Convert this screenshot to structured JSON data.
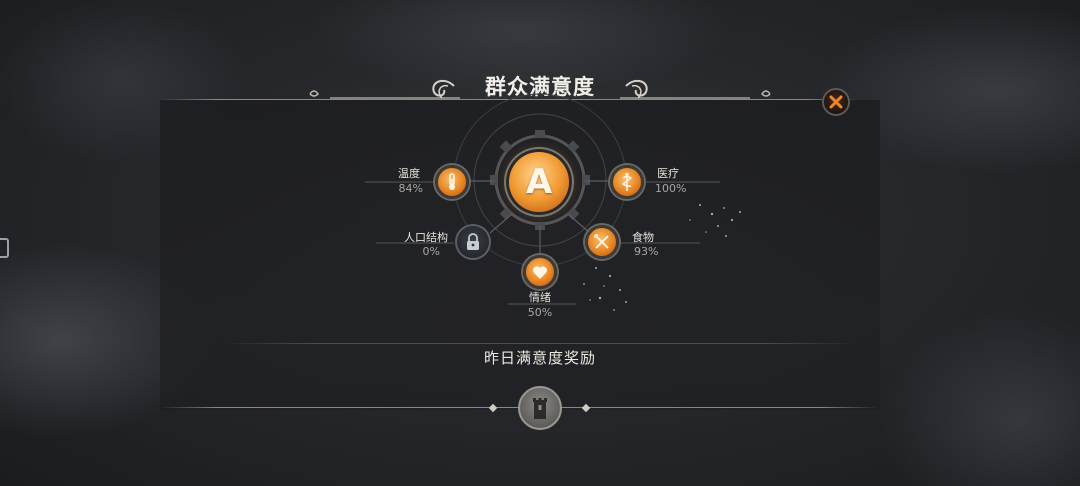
{
  "panel": {
    "title": "群众满意度",
    "grade": "A",
    "reward_title": "昨日满意度奖励"
  },
  "factors": {
    "temperature": {
      "label": "温度",
      "value": "84%",
      "icon": "thermometer-icon"
    },
    "medical": {
      "label": "医疗",
      "value": "100%",
      "icon": "caduceus-icon"
    },
    "population": {
      "label": "人口结构",
      "value": "0%",
      "icon": "lock-icon"
    },
    "food": {
      "label": "食物",
      "value": "93%",
      "icon": "fork-knife-icon"
    },
    "mood": {
      "label": "情绪",
      "value": "50%",
      "icon": "heart-icon"
    }
  },
  "icons": {
    "close": "close-icon",
    "reward": "tower-icon"
  },
  "colors": {
    "accent": "#f09a35",
    "panel": "#1e1f22",
    "text": "#ece8e0",
    "muted": "#a9a6a0"
  }
}
